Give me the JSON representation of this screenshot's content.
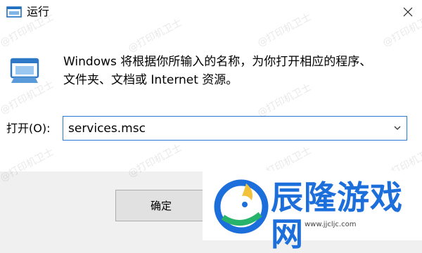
{
  "window": {
    "title": "运行"
  },
  "description": {
    "line1": "Windows 将根据你所输入的名称，为你打开相应的程序、",
    "line2": "文件夹、文档或 Internet 资源。"
  },
  "open_field": {
    "label": "打开(O):",
    "value": "services.msc"
  },
  "buttons": {
    "ok_label": "确定"
  },
  "watermark_text": "@打印机卫士",
  "overlay": {
    "brand_text": "辰隆游戏网",
    "url": "www.jjcljc.com"
  },
  "icons": {
    "close": "close-icon",
    "app": "run-app-icon",
    "dropdown": "chevron-down-icon"
  },
  "colors": {
    "focus_border": "#2a7ad5",
    "brand": "#1c6fdb"
  }
}
